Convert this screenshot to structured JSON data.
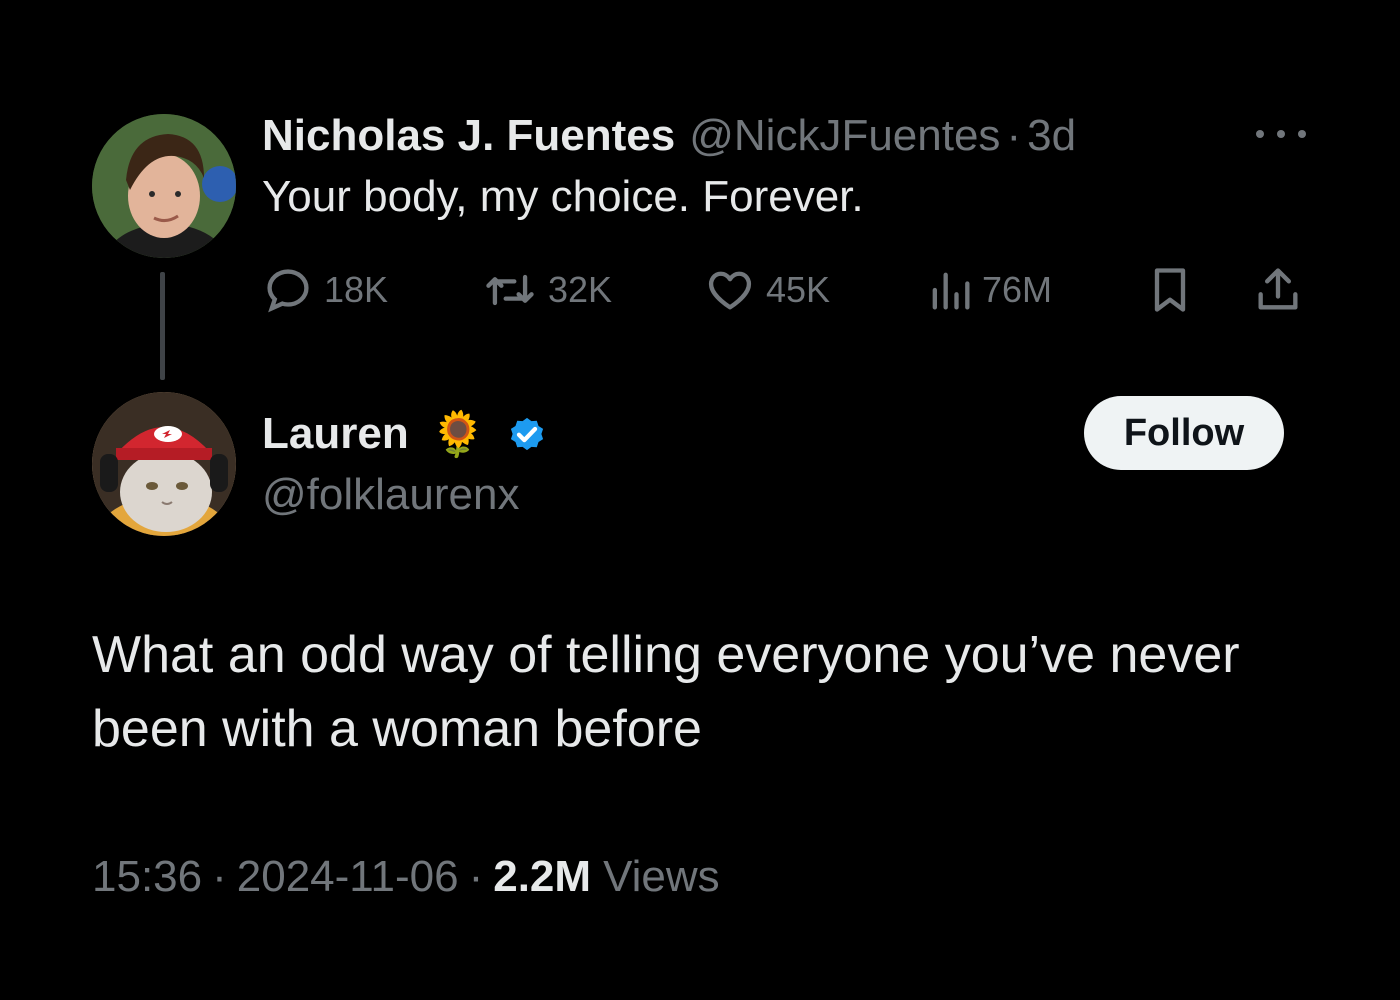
{
  "parent_tweet": {
    "display_name": "Nicholas J. Fuentes",
    "handle": "@NickJFuentes",
    "separator": "·",
    "age": "3d",
    "text": "Your body, my choice. Forever.",
    "avatar_icon": "profile-photo",
    "more_icon": "more-horizontal-icon",
    "actions": {
      "replies": "18K",
      "retweets": "32K",
      "likes": "45K",
      "views": "76M"
    }
  },
  "reply_tweet": {
    "display_name": "Lauren",
    "emoji": "🌻",
    "verified": true,
    "verified_color": "#1d9bf0",
    "handle": "@folklaurenx",
    "follow_label": "Follow",
    "avatar_icon": "cat-with-headphones-photo",
    "text": "What an odd way of telling everyone you’ve never been with a woman before",
    "time": "15:36",
    "separator": "·",
    "date": "2024-11-06",
    "views_count": "2.2M",
    "views_label": "Views"
  },
  "colors": {
    "background": "#000000",
    "primary_text": "#e7e9ea",
    "secondary_text": "#71767b",
    "thread_line": "#3f4347",
    "follow_button_bg": "#eff3f4"
  }
}
